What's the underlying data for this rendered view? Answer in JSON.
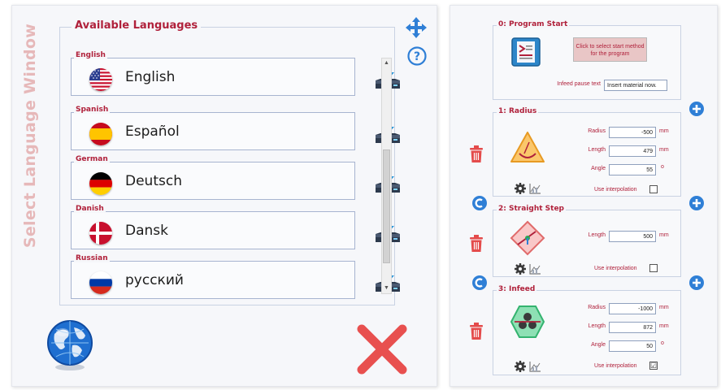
{
  "left": {
    "vertical_title": "Select Language Window",
    "group_title": "Available Languages",
    "languages": [
      {
        "label": "English",
        "name": "English",
        "flag": "us-flag-icon"
      },
      {
        "label": "Spanish",
        "name": "Español",
        "flag": "spain-flag-icon"
      },
      {
        "label": "German",
        "name": "Deutsch",
        "flag": "germany-flag-icon"
      },
      {
        "label": "Danish",
        "name": "Dansk",
        "flag": "denmark-flag-icon"
      },
      {
        "label": "Russian",
        "name": "русский",
        "flag": "russia-flag-icon"
      }
    ],
    "icons": [
      "download-icon",
      "move-icon",
      "help-icon",
      "globe-icon",
      "close-icon"
    ]
  },
  "right": {
    "program_start": {
      "title": "0: Program Start",
      "button_line1": "Click to select start method",
      "button_line2": "for the program",
      "infeed_label": "Infeed pause text",
      "infeed_value": "Insert material now."
    },
    "radius": {
      "title": "1: Radius",
      "radius_label": "Radius",
      "radius_value": "-500",
      "radius_unit": "mm",
      "length_label": "Length",
      "length_value": "479",
      "length_unit": "mm",
      "angle_label": "Angle",
      "angle_value": "55",
      "angle_unit": "o",
      "interp_label": "Use interpolation",
      "interp_checked": false
    },
    "straight": {
      "title": "2: Straight Step",
      "length_label": "Length",
      "length_value": "500",
      "length_unit": "mm",
      "interp_label": "Use interpolation",
      "interp_checked": false
    },
    "infeed": {
      "title": "3: Infeed",
      "radius_label": "Radius",
      "radius_value": "-1000",
      "radius_unit": "mm",
      "length_label": "Length",
      "length_value": "872",
      "length_unit": "mm",
      "angle_label": "Angle",
      "angle_value": "50",
      "angle_unit": "o",
      "interp_label": "Use interpolation",
      "interp_checked": true,
      "interp_mark": "☑"
    }
  },
  "colors": {
    "accent_red": "#b0213b",
    "title_pink": "#e6b8b9",
    "blue": "#2f7fd6",
    "delete_red": "#e44b4b"
  }
}
